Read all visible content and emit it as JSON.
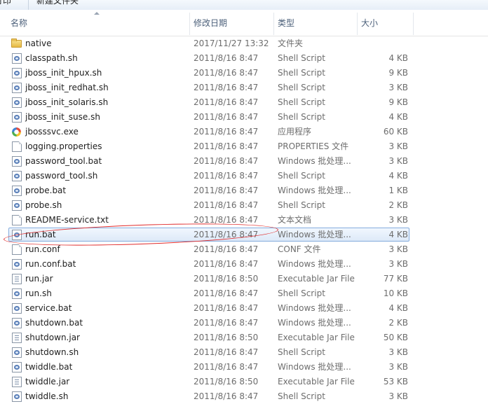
{
  "toolbar": {
    "print_label": "打印",
    "new_folder_label": "新建文件夹"
  },
  "columns": {
    "name": "名称",
    "date": "修改日期",
    "type": "类型",
    "size": "大小"
  },
  "rows": [
    {
      "name": "native",
      "date": "2017/11/27 13:32",
      "type": "文件夹",
      "size": "",
      "icon": "folder-icon"
    },
    {
      "name": "classpath.sh",
      "date": "2011/8/16 8:47",
      "type": "Shell Script",
      "size": "4 KB",
      "icon": "script-file-icon"
    },
    {
      "name": "jboss_init_hpux.sh",
      "date": "2011/8/16 8:47",
      "type": "Shell Script",
      "size": "9 KB",
      "icon": "script-file-icon"
    },
    {
      "name": "jboss_init_redhat.sh",
      "date": "2011/8/16 8:47",
      "type": "Shell Script",
      "size": "3 KB",
      "icon": "script-file-icon"
    },
    {
      "name": "jboss_init_solaris.sh",
      "date": "2011/8/16 8:47",
      "type": "Shell Script",
      "size": "9 KB",
      "icon": "script-file-icon"
    },
    {
      "name": "jboss_init_suse.sh",
      "date": "2011/8/16 8:47",
      "type": "Shell Script",
      "size": "4 KB",
      "icon": "script-file-icon"
    },
    {
      "name": "jbosssvc.exe",
      "date": "2011/8/16 8:47",
      "type": "应用程序",
      "size": "60 KB",
      "icon": "application-icon"
    },
    {
      "name": "logging.properties",
      "date": "2011/8/16 8:47",
      "type": "PROPERTIES 文件",
      "size": "3 KB",
      "icon": "document-icon"
    },
    {
      "name": "password_tool.bat",
      "date": "2011/8/16 8:47",
      "type": "Windows 批处理...",
      "size": "3 KB",
      "icon": "script-file-icon"
    },
    {
      "name": "password_tool.sh",
      "date": "2011/8/16 8:47",
      "type": "Shell Script",
      "size": "4 KB",
      "icon": "script-file-icon"
    },
    {
      "name": "probe.bat",
      "date": "2011/8/16 8:47",
      "type": "Windows 批处理...",
      "size": "1 KB",
      "icon": "script-file-icon"
    },
    {
      "name": "probe.sh",
      "date": "2011/8/16 8:47",
      "type": "Shell Script",
      "size": "2 KB",
      "icon": "script-file-icon"
    },
    {
      "name": "README-service.txt",
      "date": "2011/8/16 8:47",
      "type": "文本文档",
      "size": "3 KB",
      "icon": "document-icon"
    },
    {
      "name": "run.bat",
      "date": "2011/8/16 8:47",
      "type": "Windows 批处理...",
      "size": "4 KB",
      "icon": "script-file-icon",
      "selected": true
    },
    {
      "name": "run.conf",
      "date": "2011/8/16 8:47",
      "type": "CONF 文件",
      "size": "3 KB",
      "icon": "document-icon"
    },
    {
      "name": "run.conf.bat",
      "date": "2011/8/16 8:47",
      "type": "Windows 批处理...",
      "size": "3 KB",
      "icon": "script-file-icon"
    },
    {
      "name": "run.jar",
      "date": "2011/8/16 8:50",
      "type": "Executable Jar File",
      "size": "77 KB",
      "icon": "jar-file-icon"
    },
    {
      "name": "run.sh",
      "date": "2011/8/16 8:47",
      "type": "Shell Script",
      "size": "10 KB",
      "icon": "script-file-icon"
    },
    {
      "name": "service.bat",
      "date": "2011/8/16 8:47",
      "type": "Windows 批处理...",
      "size": "4 KB",
      "icon": "script-file-icon"
    },
    {
      "name": "shutdown.bat",
      "date": "2011/8/16 8:47",
      "type": "Windows 批处理...",
      "size": "2 KB",
      "icon": "script-file-icon"
    },
    {
      "name": "shutdown.jar",
      "date": "2011/8/16 8:50",
      "type": "Executable Jar File",
      "size": "50 KB",
      "icon": "jar-file-icon"
    },
    {
      "name": "shutdown.sh",
      "date": "2011/8/16 8:47",
      "type": "Shell Script",
      "size": "3 KB",
      "icon": "script-file-icon"
    },
    {
      "name": "twiddle.bat",
      "date": "2011/8/16 8:47",
      "type": "Windows 批处理...",
      "size": "3 KB",
      "icon": "script-file-icon"
    },
    {
      "name": "twiddle.jar",
      "date": "2011/8/16 8:50",
      "type": "Executable Jar File",
      "size": "53 KB",
      "icon": "jar-file-icon"
    },
    {
      "name": "twiddle.sh",
      "date": "2011/8/16 8:47",
      "type": "Shell Script",
      "size": "3 KB",
      "icon": "script-file-icon"
    }
  ],
  "colors": {
    "selection_border": "#84acdd",
    "annotation": "#e02a2a",
    "header_text": "#4c607a"
  }
}
